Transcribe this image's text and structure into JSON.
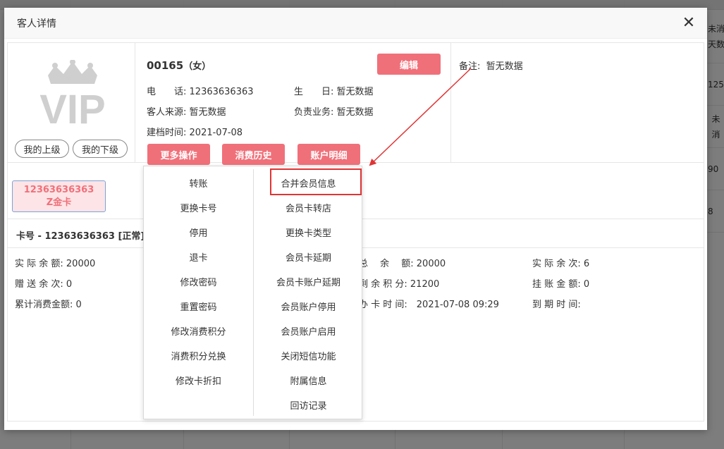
{
  "background": {
    "right_cells": [
      "未消\n天数",
      "125",
      "未消",
      "90",
      "8"
    ]
  },
  "dialog": {
    "title": "客人详情",
    "close_icon": "close-icon"
  },
  "customer": {
    "id": "00165",
    "gender": "（女）",
    "phone_label": "电　　话:",
    "phone": "12363636363",
    "birthday_label": "生　　日:",
    "birthday": "暂无数据",
    "source_label": "客人来源:",
    "source": "暂无数据",
    "manager_label": "负责业务:",
    "manager": "暂无数据",
    "created_label": "建档时间:",
    "created": "2021-07-08",
    "remark_label": "备注:",
    "remark": "暂无数据"
  },
  "buttons": {
    "my_superior": "我的上级",
    "my_subordinate": "我的下级",
    "edit": "编辑",
    "more_ops": "更多操作",
    "consume_history": "消费历史",
    "account_detail": "账户明细"
  },
  "vip_logo_text": "VIP",
  "card": {
    "tag_number": "12363636363",
    "tag_type": "Z金卡",
    "title": "卡号 - 12363636363 [正常]"
  },
  "stats": {
    "actual_balance": "实 际 余 额: 20000",
    "gift_times": "赠 送 余 次: 0",
    "total_consume": "累计消费金额: 0",
    "total_balance": "总　 余　 额: 20000",
    "remaining_points": "剩 余 积 分: 21200",
    "open_time": "办 卡 时 间:　2021-07-08 09:29",
    "actual_times": "实 际 余 次: 6",
    "credit_amount": "挂 账 金 额: 0",
    "expire_time": "到 期 时 间:"
  },
  "menu": {
    "left": [
      "转账",
      "更换卡号",
      "停用",
      "退卡",
      "修改密码",
      "重置密码",
      "修改消费积分",
      "消费积分兑换",
      "修改卡折扣"
    ],
    "right": [
      "合并会员信息",
      "会员卡转店",
      "更换卡类型",
      "会员卡延期",
      "会员卡账户延期",
      "会员账户停用",
      "会员账户启用",
      "关闭短信功能",
      "附属信息",
      "回访记录"
    ]
  },
  "colors": {
    "accent": "#f0707a",
    "highlight": "#e03434"
  }
}
